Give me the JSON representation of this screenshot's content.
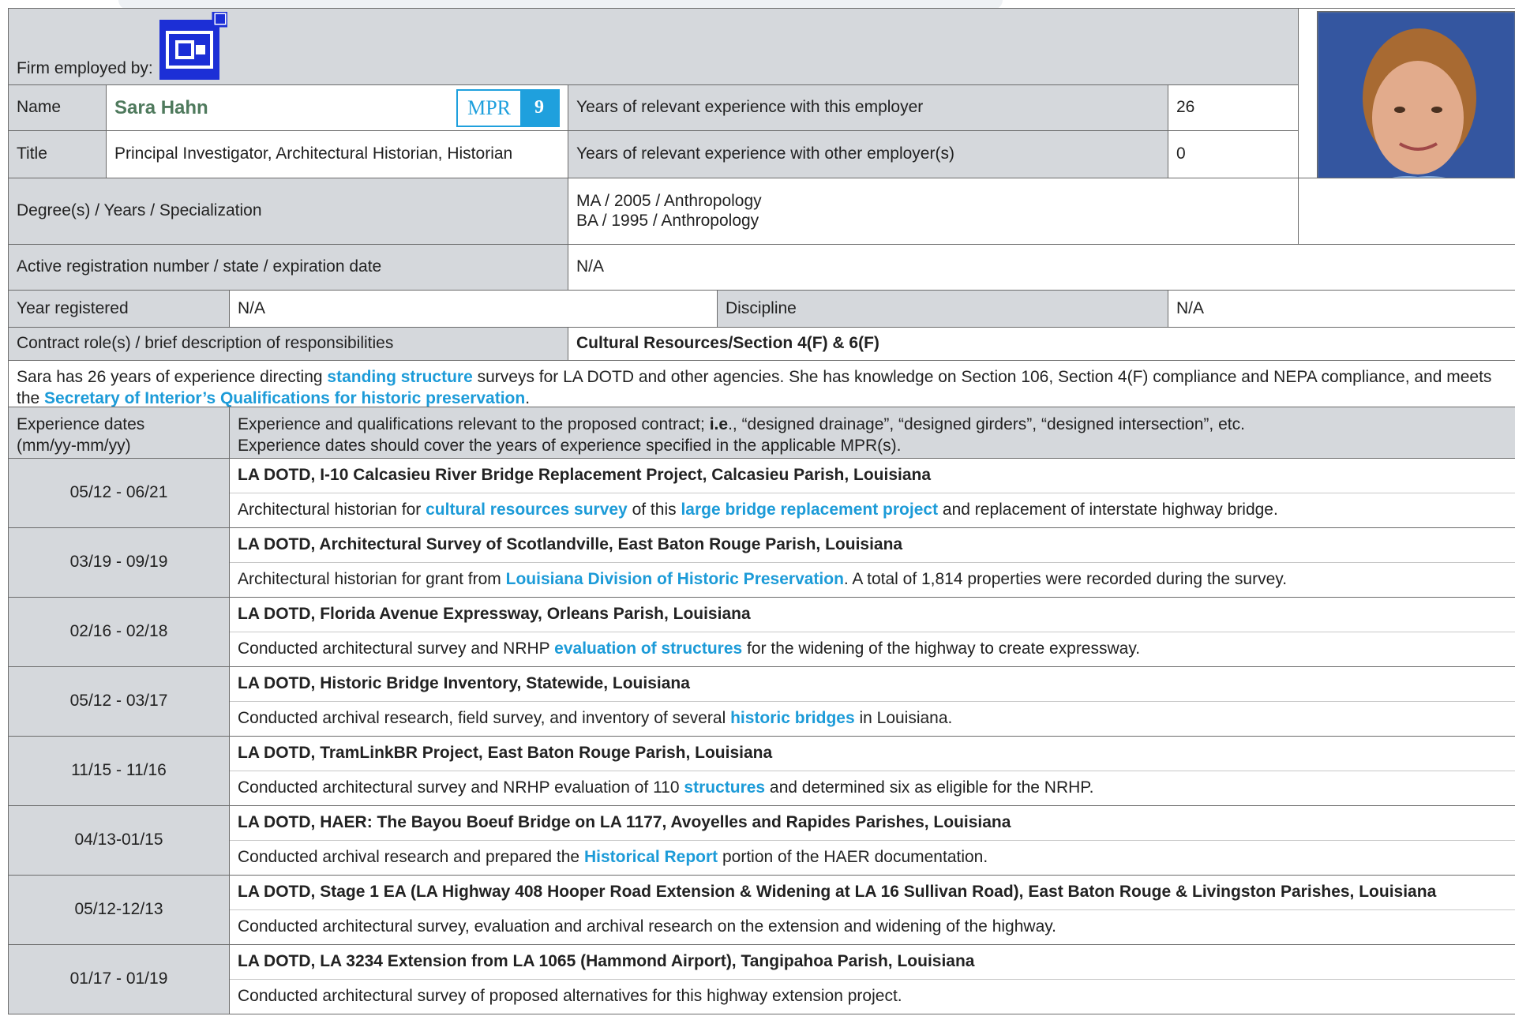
{
  "header": {
    "firm_label": "Firm employed by:",
    "logo_name": "company-logo",
    "logo_color": "#1c2fd6"
  },
  "person": {
    "name_label": "Name",
    "name": "Sara Hahn",
    "mpr_label": "MPR",
    "mpr_number": "9",
    "title_label": "Title",
    "title": "Principal Investigator, Architectural Historian, Historian",
    "years_employer_label": "Years of relevant experience with this employer",
    "years_employer": "26",
    "years_other_label": "Years of relevant experience with other employer(s)",
    "years_other": "0",
    "degree_label": "Degree(s) / Years / Specialization",
    "degree_1": "MA / 2005 / Anthropology",
    "degree_2": "BA / 1995 / Anthropology",
    "registration_label": "Active registration number / state / expiration date",
    "registration": "N/A",
    "year_registered_label": "Year registered",
    "year_registered": "N/A",
    "discipline_label": "Discipline",
    "discipline": "N/A",
    "role_label": "Contract role(s) / brief description of responsibilities",
    "role": "Cultural Resources/Section 4(F) & 6(F)"
  },
  "summary": {
    "part1": "Sara has 26 years of experience directing ",
    "hl1": "standing structure",
    "part2": " surveys for LA DOTD and other agencies. She has knowledge on Section 106, Section 4(F) compliance and NEPA compliance, and meets the ",
    "hl2": "Secretary of Interior’s Qualifications for historic preservation",
    "part3": "."
  },
  "experience_header": {
    "dates_label_1": "Experience dates",
    "dates_label_2": "(mm/yy-mm/yy)",
    "desc_1a": "Experience and qualifications relevant to the proposed contract; ",
    "desc_1b": "i.e",
    "desc_1c": "., “designed drainage”, “designed girders”, “designed intersection”, etc.",
    "desc_2": "Experience dates should cover the years of experience specified in the applicable MPR(s)."
  },
  "projects": [
    {
      "dates": "05/12 - 06/21",
      "title": "LA DOTD, I-10 Calcasieu River Bridge Replacement Project, Calcasieu Parish, Louisiana",
      "d1": "Architectural historian for ",
      "h1": "cultural resources survey",
      "d2": " of this ",
      "h2": "large bridge replacement project",
      "d3": " and replacement of interstate highway bridge."
    },
    {
      "dates": "03/19 - 09/19",
      "title": "LA DOTD, Architectural Survey of Scotlandville, East Baton Rouge Parish, Louisiana",
      "d1": "Architectural historian for grant from ",
      "h1": "Louisiana Division of Historic Preservation",
      "d2": ". A total of 1,814 properties were recorded during the survey.",
      "h2": "",
      "d3": ""
    },
    {
      "dates": "02/16 - 02/18",
      "title": "LA DOTD, Florida Avenue Expressway, Orleans Parish, Louisiana",
      "d1": "Conducted architectural survey and NRHP ",
      "h1": "evaluation of structures",
      "d2": " for the widening of the highway to create expressway.",
      "h2": "",
      "d3": ""
    },
    {
      "dates": "05/12 - 03/17",
      "title": "LA DOTD, Historic Bridge Inventory, Statewide, Louisiana",
      "d1": "Conducted archival research, field survey, and inventory of several ",
      "h1": "historic bridges",
      "d2": " in Louisiana.",
      "h2": "",
      "d3": ""
    },
    {
      "dates": "11/15 - 11/16",
      "title": "LA DOTD, TramLinkBR Project, East Baton Rouge Parish, Louisiana",
      "d1": "Conducted architectural survey and NRHP evaluation of 110 ",
      "h1": "structures",
      "d2": " and determined six as eligible for the NRHP.",
      "h2": "",
      "d3": ""
    },
    {
      "dates": "04/13-01/15",
      "title": "LA DOTD, HAER: The Bayou Boeuf Bridge on LA 1177, Avoyelles and Rapides Parishes, Louisiana",
      "d1": "Conducted archival research and prepared the ",
      "h1": "Historical Report",
      "d2": " portion of the HAER documentation.",
      "h2": "",
      "d3": ""
    },
    {
      "dates": "05/12-12/13",
      "title": "LA DOTD, Stage 1 EA (LA Highway 408 Hooper Road Extension & Widening at LA 16 Sullivan Road), East Baton Rouge & Livingston Parishes, Louisiana",
      "d1": "Conducted architectural survey, evaluation and archival research on the extension and widening of the highway.",
      "h1": "",
      "d2": "",
      "h2": "",
      "d3": ""
    },
    {
      "dates": "01/17 - 01/19",
      "title": "LA DOTD, LA 3234 Extension from LA 1065 (Hammond Airport), Tangipahoa Parish, Louisiana",
      "d1": "Conducted architectural survey of proposed alternatives for this highway extension project.",
      "h1": "",
      "d2": "",
      "h2": "",
      "d3": ""
    }
  ],
  "colors": {
    "accent_blue": "#1c9bd8",
    "name_green": "#4f7a5d",
    "cell_gray": "#d5d8dc"
  }
}
